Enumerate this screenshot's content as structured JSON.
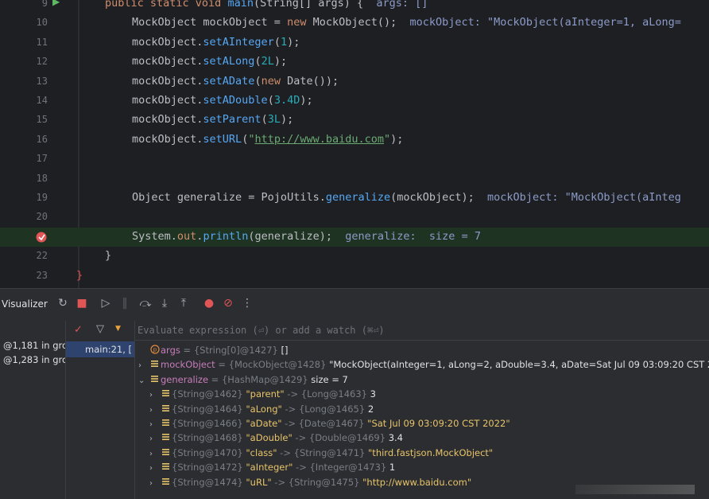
{
  "editor": {
    "lines": [
      {
        "num": "9",
        "parts": [
          [
            "kw",
            "public static void "
          ],
          [
            "mt",
            "main"
          ],
          [
            "",
            "(String[] args) {  "
          ],
          [
            "inl",
            "args: []"
          ]
        ]
      },
      {
        "num": "10",
        "parts": [
          [
            "",
            "MockObject mockObject = "
          ],
          [
            "kw",
            "new "
          ],
          [
            "",
            "MockObject();  "
          ],
          [
            "inl",
            "mockObject: \"MockObject(aInteger=1, aLong="
          ]
        ]
      },
      {
        "num": "11",
        "parts": [
          [
            "",
            "mockObject."
          ],
          [
            "mt",
            "setAInteger"
          ],
          [
            "",
            "("
          ],
          [
            "nm",
            "1"
          ],
          [
            "",
            ");"
          ]
        ]
      },
      {
        "num": "12",
        "parts": [
          [
            "",
            "mockObject."
          ],
          [
            "mt",
            "setALong"
          ],
          [
            "",
            "("
          ],
          [
            "nm",
            "2L"
          ],
          [
            "",
            ");"
          ]
        ]
      },
      {
        "num": "13",
        "parts": [
          [
            "",
            "mockObject."
          ],
          [
            "mt",
            "setADate"
          ],
          [
            "",
            "("
          ],
          [
            "kw",
            "new "
          ],
          [
            "",
            "Date());"
          ]
        ]
      },
      {
        "num": "14",
        "parts": [
          [
            "",
            "mockObject."
          ],
          [
            "mt",
            "setADouble"
          ],
          [
            "",
            "("
          ],
          [
            "nm",
            "3.4D"
          ],
          [
            "",
            ");"
          ]
        ]
      },
      {
        "num": "15",
        "parts": [
          [
            "",
            "mockObject."
          ],
          [
            "mt",
            "setParent"
          ],
          [
            "",
            "("
          ],
          [
            "nm",
            "3L"
          ],
          [
            "",
            ");"
          ]
        ]
      },
      {
        "num": "16",
        "parts": [
          [
            "",
            "mockObject."
          ],
          [
            "mt",
            "setURL"
          ],
          [
            "",
            "("
          ],
          [
            "st",
            "\""
          ],
          [
            "stu",
            "http://www.baidu.com"
          ],
          [
            "st",
            "\""
          ],
          [
            "",
            ");"
          ]
        ]
      },
      {
        "num": "17",
        "parts": []
      },
      {
        "num": "18",
        "parts": []
      },
      {
        "num": "19",
        "parts": [
          [
            "",
            "Object generalize = PojoUtils."
          ],
          [
            "mt",
            "generalize"
          ],
          [
            "",
            "(mockObject);  "
          ],
          [
            "inl",
            "mockObject: \"MockObject(aInteg"
          ]
        ]
      },
      {
        "num": "20",
        "parts": []
      },
      {
        "num": "",
        "parts": [
          [
            "",
            "System."
          ],
          [
            "kw",
            "out"
          ],
          [
            "",
            "."
          ],
          [
            "mt",
            "println"
          ],
          [
            "",
            "(generalize);  "
          ],
          [
            "inl",
            "generalize:  size = 7"
          ]
        ]
      },
      {
        "num": "22",
        "parts": [
          [
            "brace",
            "}"
          ]
        ]
      },
      {
        "num": "23",
        "parts": [
          [
            "brace-r",
            "}"
          ]
        ]
      }
    ]
  },
  "toolbar": {
    "label": "Visualizer"
  },
  "threads": {
    "items": [
      "@1,181 in grou",
      "@1,283 in grc"
    ]
  },
  "frames": {
    "selected": "main:21, [",
    "filter_icon": "filter-icon"
  },
  "variables": {
    "eval_placeholder": "Evaluate expression (⏎) or add a watch (⌘⏎)",
    "rows": [
      {
        "indent": 0,
        "arrow": "",
        "icon": "p",
        "name": "args",
        "type": " = {String[0]@1427} ",
        "value": "[]"
      },
      {
        "indent": 0,
        "arrow": ">",
        "icon": "list",
        "name": "mockObject",
        "type": " = {MockObject@1428} ",
        "value": "\"MockObject(aInteger=1, aLong=2, aDouble=3.4, aDate=Sat Jul 09 03:09:20 CST 2"
      },
      {
        "indent": 0,
        "arrow": "v",
        "icon": "list",
        "name": "generalize",
        "type": " = {HashMap@1429} ",
        "value": "size = 7"
      },
      {
        "indent": 1,
        "arrow": ">",
        "icon": "list",
        "key_type": "{String@1462} ",
        "key": "\"parent\"",
        "val_type": " -> {Long@1463} ",
        "value": "3"
      },
      {
        "indent": 1,
        "arrow": ">",
        "icon": "list",
        "key_type": "{String@1464} ",
        "key": "\"aLong\"",
        "val_type": " -> {Long@1465} ",
        "value": "2"
      },
      {
        "indent": 1,
        "arrow": ">",
        "icon": "list",
        "key_type": "{String@1466} ",
        "key": "\"aDate\"",
        "val_type": " -> {Date@1467} ",
        "value": "\"Sat Jul 09 03:09:20 CST 2022\""
      },
      {
        "indent": 1,
        "arrow": ">",
        "icon": "list",
        "key_type": "{String@1468} ",
        "key": "\"aDouble\"",
        "val_type": " -> {Double@1469} ",
        "value": "3.4"
      },
      {
        "indent": 1,
        "arrow": ">",
        "icon": "list",
        "key_type": "{String@1470} ",
        "key": "\"class\"",
        "val_type": " -> {String@1471} ",
        "value": "\"third.fastjson.MockObject\""
      },
      {
        "indent": 1,
        "arrow": ">",
        "icon": "list",
        "key_type": "{String@1472} ",
        "key": "\"aInteger\"",
        "val_type": " -> {Integer@1473} ",
        "value": "1"
      },
      {
        "indent": 1,
        "arrow": ">",
        "icon": "list",
        "key_type": "{String@1474} ",
        "key": "\"uRL\"",
        "val_type": " -> {String@1475} ",
        "value": "\"http://www.baidu.com\""
      }
    ]
  },
  "colors": {
    "background": "#1e1f22",
    "panel": "#2b2d30",
    "keyword": "#cf8e6d",
    "method": "#56a8f5",
    "number": "#2aacb8",
    "string": "#6aab73",
    "inline_hint": "#8c9bc9",
    "current_line": "#1f3323",
    "breakpoint": "#e05555"
  }
}
